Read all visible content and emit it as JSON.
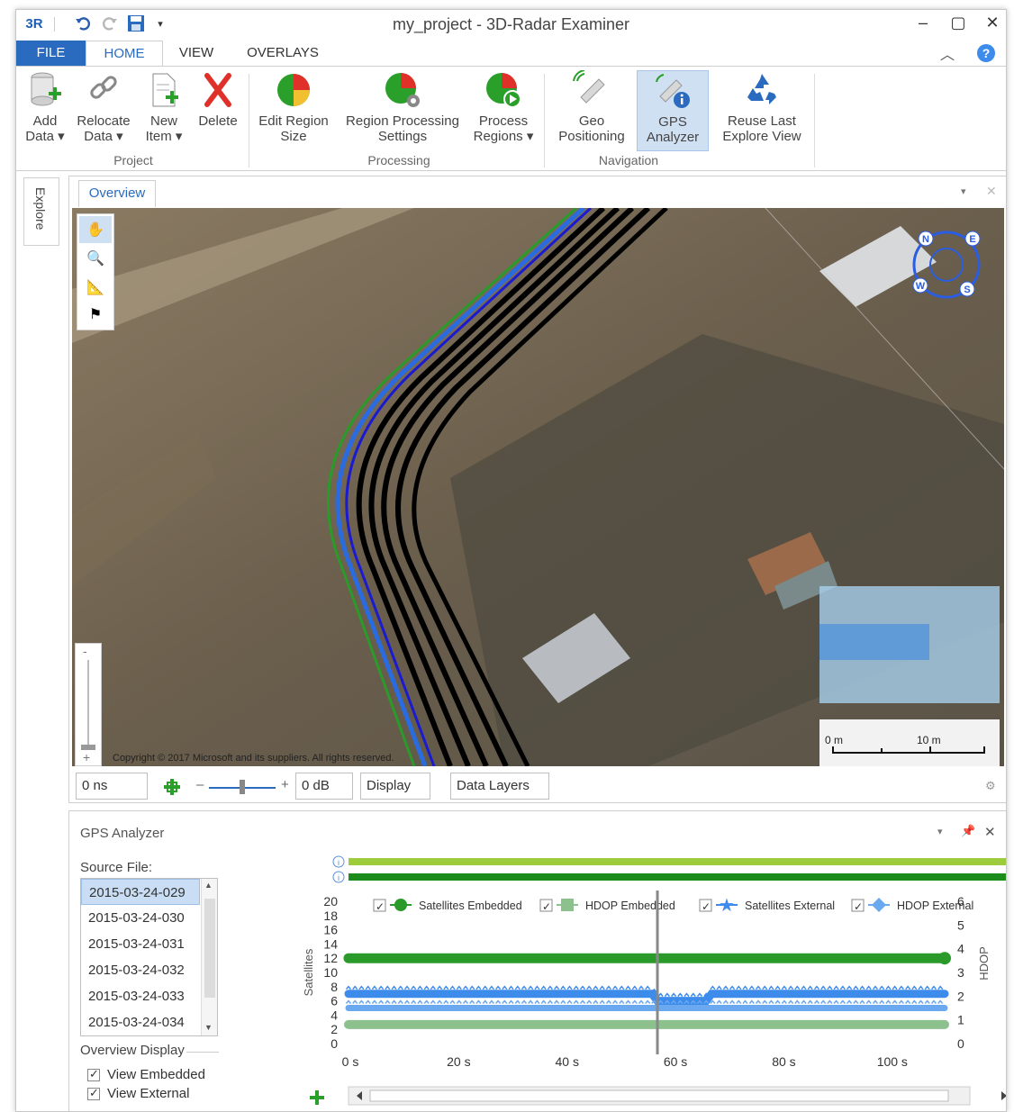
{
  "window": {
    "title": "my_project - 3D-Radar Examiner",
    "app_logo": "3R"
  },
  "qat": {
    "undo_icon": "undo-icon",
    "redo_icon": "redo-icon",
    "save_icon": "save-icon",
    "customize_icon": "dropdown-icon"
  },
  "tabs": [
    {
      "label": "FILE"
    },
    {
      "label": "HOME"
    },
    {
      "label": "VIEW"
    },
    {
      "label": "OVERLAYS"
    }
  ],
  "ribbon": {
    "groups": [
      {
        "label": "Project"
      },
      {
        "label": "Processing"
      },
      {
        "label": "Navigation"
      }
    ],
    "buttons": {
      "add_data": {
        "line1": "Add",
        "line2": "Data ▾"
      },
      "relocate_data": {
        "line1": "Relocate",
        "line2": "Data ▾"
      },
      "new_item": {
        "line1": "New",
        "line2": "Item ▾"
      },
      "delete": {
        "line1": "Delete",
        "line2": ""
      },
      "edit_region_size": {
        "line1": "Edit Region",
        "line2": "Size"
      },
      "region_processing_settings": {
        "line1": "Region Processing",
        "line2": "Settings"
      },
      "process_regions": {
        "line1": "Process",
        "line2": "Regions ▾"
      },
      "geo_positioning": {
        "line1": "Geo",
        "line2": "Positioning"
      },
      "gps_analyzer": {
        "line1": "GPS",
        "line2": "Analyzer"
      },
      "reuse_last_explore_view": {
        "line1": "Reuse Last",
        "line2": "Explore View"
      }
    }
  },
  "sidebar": {
    "explore_label": "Explore"
  },
  "overview": {
    "tab_label": "Overview",
    "copyright": "Copyright © 2017 Microsoft and its suppliers. All rights reserved.",
    "compass": {
      "n": "N",
      "e": "E",
      "s": "S",
      "w": "W"
    },
    "scale": {
      "left": "0 m",
      "right": "10 m"
    },
    "footer": {
      "time_value": "0 ns",
      "gain_value": "0 dB",
      "display_label": "Display",
      "data_layers_label": "Data Layers",
      "minus": "–",
      "plus": "+"
    }
  },
  "gps_analyzer": {
    "title": "GPS Analyzer",
    "source_file_label": "Source File:",
    "files": [
      "2015-03-24-029",
      "2015-03-24-030",
      "2015-03-24-031",
      "2015-03-24-032",
      "2015-03-24-033",
      "2015-03-24-034"
    ],
    "selected_file": "2015-03-24-029",
    "overview_display_label": "Overview Display",
    "view_embedded": "View Embedded",
    "view_external": "View External"
  },
  "chart_data": {
    "type": "line",
    "ylabel": "Satellites",
    "y2label": "HDOP",
    "ylim": [
      0,
      20
    ],
    "y2lim": [
      0,
      6
    ],
    "yticks": [
      0,
      2,
      4,
      6,
      8,
      10,
      12,
      14,
      16,
      18,
      20
    ],
    "y2ticks": [
      0,
      1,
      2,
      3,
      4,
      5,
      6
    ],
    "xticks": [
      "0 s",
      "20 s",
      "40 s",
      "60 s",
      "80 s",
      "100 s"
    ],
    "xlim": [
      0,
      110
    ],
    "cursor_x": 57,
    "series": [
      {
        "name": "Satellites Embedded",
        "color": "#2a9a2a",
        "axis": "left",
        "x": [
          0,
          110
        ],
        "y": [
          12,
          12
        ]
      },
      {
        "name": "HDOP Embedded",
        "color": "#8cc08c",
        "axis": "right",
        "x": [
          0,
          20,
          40,
          57,
          60,
          80,
          110
        ],
        "y": [
          0.8,
          0.8,
          0.8,
          0.8,
          0.8,
          0.8,
          0.8
        ]
      },
      {
        "name": "Satellites External",
        "color": "#3d8bea",
        "axis": "left",
        "x": [
          0,
          56,
          57,
          66,
          67,
          110
        ],
        "y": [
          7,
          7,
          6,
          6,
          7,
          7
        ]
      },
      {
        "name": "HDOP External",
        "color": "#6aa8f0",
        "axis": "right",
        "x": [
          0,
          110
        ],
        "y": [
          1.5,
          1.5
        ]
      }
    ],
    "bars": [
      {
        "color": "#9ccc3c"
      },
      {
        "color": "#1c8c1c"
      }
    ]
  }
}
